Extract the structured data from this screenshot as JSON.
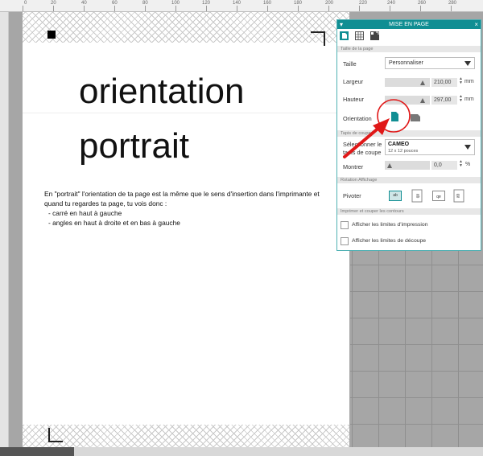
{
  "ruler": {
    "labels": [
      "0",
      "20",
      "40",
      "60",
      "80",
      "100",
      "120",
      "140",
      "160",
      "180",
      "200",
      "220",
      "240",
      "260",
      "280"
    ]
  },
  "page": {
    "heading_line1": "orientation",
    "heading_line2": "portrait",
    "paragraph": {
      "line1": "En \"portrait\" l'orientation de ta page est la même que le sens d'insertion dans l'imprimante et",
      "line2": "quand tu regardes ta page, tu vois donc :",
      "bullet1": "- carré en haut à gauche",
      "bullet2": "- angles en haut à droite et en bas à gauche"
    }
  },
  "panel": {
    "title": "MISE EN PAGE",
    "title_left_icon": "chevron-down-icon",
    "close_symbol": "×",
    "section_page_size": "Taille de la page",
    "size_label": "Taille",
    "size_value": "Personnaliser",
    "width_label": "Largeur",
    "width_value": "210,00",
    "width_unit": "mm",
    "height_label": "Hauteur",
    "height_value": "297,00",
    "height_unit": "mm",
    "orientation_label": "Orientation",
    "section_mat": "Tapis de coupe",
    "mat_label_line1": "Sélectionner le",
    "mat_label_line2": "tapis de coupe",
    "mat_value": "CAMEO",
    "mat_sub": "12 x 12 pouces",
    "show_label": "Montrer",
    "show_value": "0,0",
    "show_unit": "%",
    "section_rotation": "Rotation Affichage",
    "rotate_label": "Pivoter",
    "rotate_options": [
      "ab",
      "ab",
      "ab",
      "ab"
    ],
    "section_print": "Imprimer et couper les contours",
    "print_limits": "Afficher les limites d'impression",
    "cut_limits": "Afficher les limites de découpe",
    "print_limits_checked": false,
    "cut_limits_checked": false
  },
  "colors": {
    "accent": "#108e93",
    "annotation": "#e01818"
  }
}
